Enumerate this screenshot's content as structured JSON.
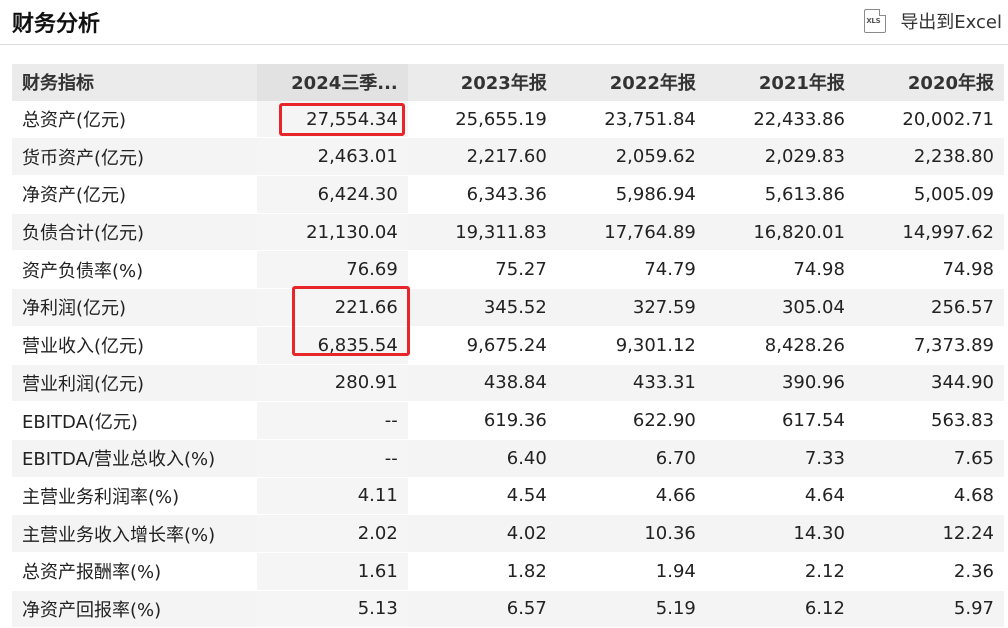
{
  "header": {
    "title": "财务分析",
    "export_label": "导出到Excel",
    "export_icon_text": "XLS"
  },
  "table": {
    "columns": [
      "财务指标",
      "2024三季...",
      "2023年报",
      "2022年报",
      "2021年报",
      "2020年报"
    ],
    "rows": [
      [
        "总资产(亿元)",
        "27,554.34",
        "25,655.19",
        "23,751.84",
        "22,433.86",
        "20,002.71"
      ],
      [
        "货币资产(亿元)",
        "2,463.01",
        "2,217.60",
        "2,059.62",
        "2,029.83",
        "2,238.80"
      ],
      [
        "净资产(亿元)",
        "6,424.30",
        "6,343.36",
        "5,986.94",
        "5,613.86",
        "5,005.09"
      ],
      [
        "负债合计(亿元)",
        "21,130.04",
        "19,311.83",
        "17,764.89",
        "16,820.01",
        "14,997.62"
      ],
      [
        "资产负债率(%)",
        "76.69",
        "75.27",
        "74.79",
        "74.98",
        "74.98"
      ],
      [
        "净利润(亿元)",
        "221.66",
        "345.52",
        "327.59",
        "305.04",
        "256.57"
      ],
      [
        "营业收入(亿元)",
        "6,835.54",
        "9,675.24",
        "9,301.12",
        "8,428.26",
        "7,373.89"
      ],
      [
        "营业利润(亿元)",
        "280.91",
        "438.84",
        "433.31",
        "390.96",
        "344.90"
      ],
      [
        "EBITDA(亿元)",
        "--",
        "619.36",
        "622.90",
        "617.54",
        "563.83"
      ],
      [
        "EBITDA/营业总收入(%)",
        "--",
        "6.40",
        "6.70",
        "7.33",
        "7.65"
      ],
      [
        "主营业务利润率(%)",
        "4.11",
        "4.54",
        "4.66",
        "4.64",
        "4.68"
      ],
      [
        "主营业务收入增长率(%)",
        "2.02",
        "4.02",
        "10.36",
        "14.30",
        "12.24"
      ],
      [
        "总资产报酬率(%)",
        "1.61",
        "1.82",
        "1.94",
        "2.12",
        "2.36"
      ],
      [
        "净资产回报率(%)",
        "5.13",
        "6.57",
        "5.19",
        "6.12",
        "5.97"
      ]
    ]
  },
  "colors": {
    "highlight": "#e8262a",
    "header_bg": "#ebebeb",
    "stripe_bg": "#f4f4f4"
  }
}
